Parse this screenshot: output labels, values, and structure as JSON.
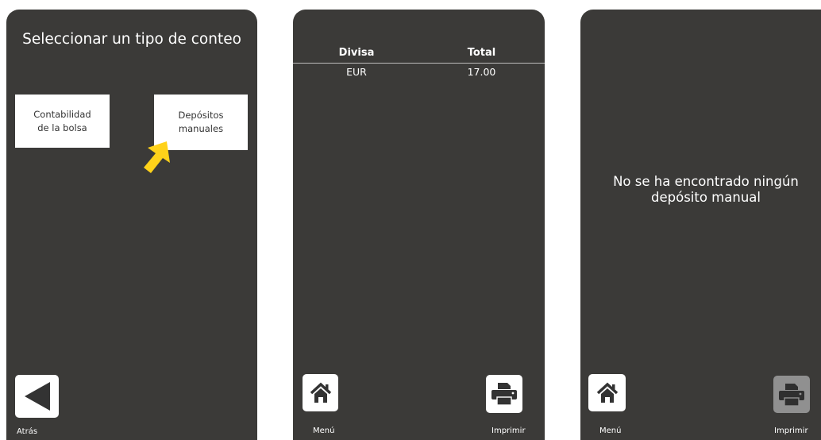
{
  "count_type_screen": {
    "title": "Seleccionar un tipo de conteo",
    "options": [
      {
        "label": "Contabilidad\nde la bolsa"
      },
      {
        "label": "Depósitos\nmanuales"
      }
    ],
    "back_label": "Atrás"
  },
  "totals_screen": {
    "columns": [
      "Divisa",
      "Total"
    ],
    "rows": [
      {
        "currency": "EUR",
        "total": "17.00"
      }
    ],
    "menu_label": "Menú",
    "print_label": "Imprimir"
  },
  "manual_deposit_screen": {
    "message_line1": "No se ha encontrado ningún",
    "message_line2": "depósito manual",
    "menu_label": "Menú",
    "print_label": "Imprimir",
    "print_enabled": false
  },
  "colors": {
    "panel_bg": "#3b3a38",
    "highlight_arrow": "#ffd21a",
    "disabled_button": "#909090"
  }
}
